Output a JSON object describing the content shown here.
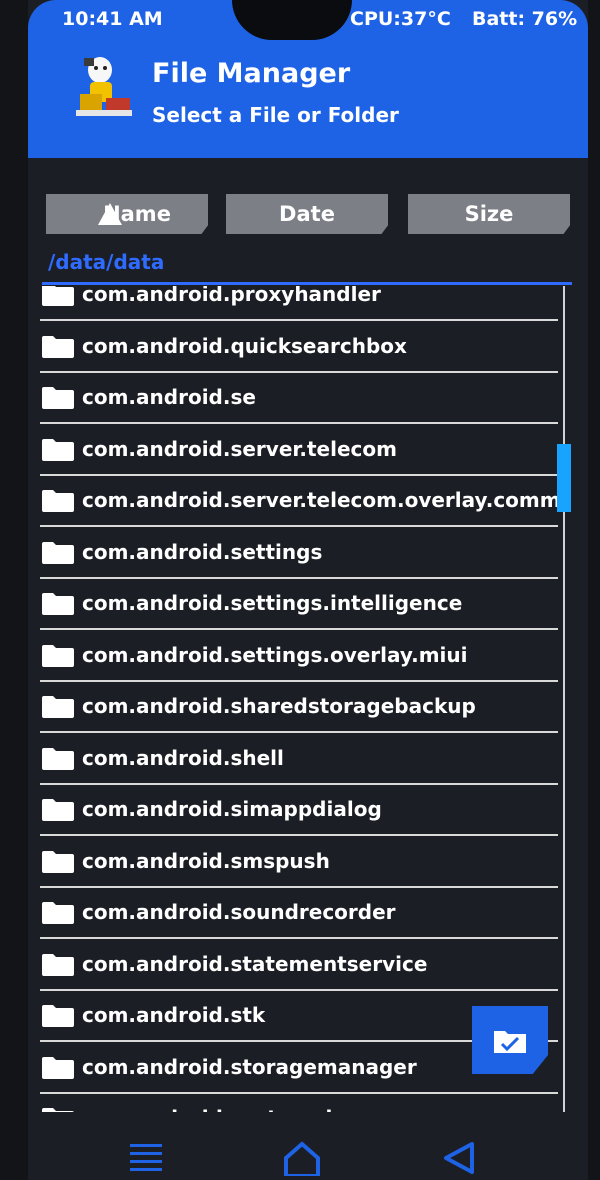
{
  "status": {
    "time": "10:41 AM",
    "cpu": "CPU:37°C",
    "battery": "Batt: 76%"
  },
  "header": {
    "title": "File Manager",
    "subtitle": "Select a File or Folder"
  },
  "sort": {
    "name_label": "Name",
    "date_label": "Date",
    "size_label": "Size"
  },
  "path": "/data/data",
  "files": [
    {
      "label": "com.android.proxyhandler"
    },
    {
      "label": "com.android.quicksearchbox"
    },
    {
      "label": "com.android.se"
    },
    {
      "label": "com.android.server.telecom"
    },
    {
      "label": "com.android.server.telecom.overlay.common"
    },
    {
      "label": "com.android.settings"
    },
    {
      "label": "com.android.settings.intelligence"
    },
    {
      "label": "com.android.settings.overlay.miui"
    },
    {
      "label": "com.android.sharedstoragebackup"
    },
    {
      "label": "com.android.shell"
    },
    {
      "label": "com.android.simappdialog"
    },
    {
      "label": "com.android.smspush"
    },
    {
      "label": "com.android.soundrecorder"
    },
    {
      "label": "com.android.statementservice"
    },
    {
      "label": "com.android.stk"
    },
    {
      "label": "com.android.storagemanager"
    },
    {
      "label": "com.android.systemui"
    }
  ],
  "colors": {
    "accent": "#1e63e6",
    "path": "#2f6bff",
    "scrollbar": "#18a3ff"
  },
  "icons": {
    "folder": "folder-icon",
    "select_folder": "folder-check-icon",
    "menu": "menu-icon",
    "home": "home-icon",
    "back": "back-icon"
  }
}
